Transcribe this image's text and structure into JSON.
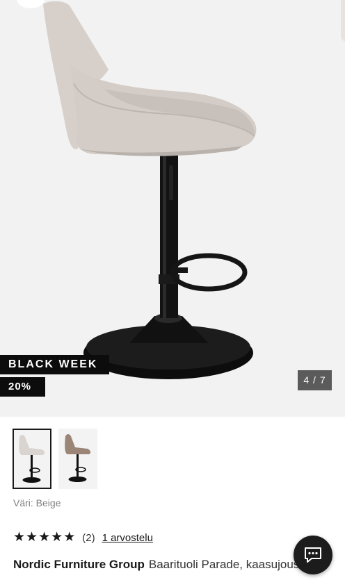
{
  "gallery": {
    "badge_primary": "BLACK WEEK",
    "badge_discount": "20%",
    "counter": "4 / 7",
    "main_image": "bar-stool-side-view",
    "background_color": "#f2f2f2"
  },
  "thumbnails": [
    {
      "name": "beige-stool-thumbnail",
      "color": "#d9d4cf",
      "selected": true
    },
    {
      "name": "brown-stool-thumbnail",
      "color": "#9a8576",
      "selected": false
    }
  ],
  "color_line": "Väri: Beige",
  "rating": {
    "stars": 5,
    "count": "(2)",
    "review_link": "1 arvostelu"
  },
  "product": {
    "brand": "Nordic Furniture Group",
    "name": "Baarituoli Parade, kaasujousi"
  },
  "chat": {
    "icon": "chat-icon",
    "color": "#1c1c1c"
  },
  "colors": {
    "badge": "#0c0c0c",
    "counter": "#5b5b5b",
    "fabric": "#d6cfca"
  }
}
